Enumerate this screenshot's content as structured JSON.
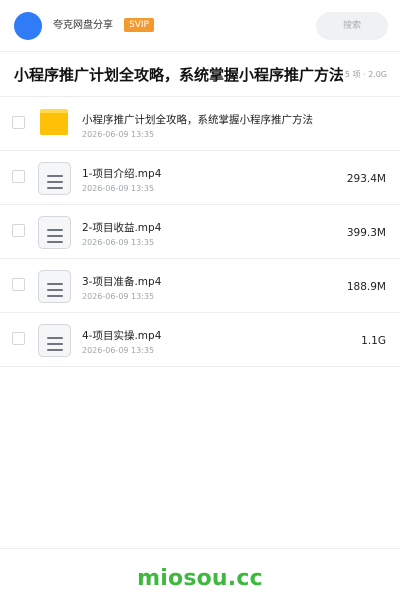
{
  "header": {
    "app_name": "夸克网盘分享",
    "badge": "SVIP",
    "search_placeholder": "搜索",
    "avatar_color": "#2f7cf6"
  },
  "title_row": {
    "title": "小程序推广计划全攻略，系统掌握小程序推广方法",
    "meta": "5 项 · 2.0G"
  },
  "files": [
    {
      "type": "folder",
      "icon": "folder-icon",
      "name": "小程序推广计划全攻略，系统掌握小程序推广方法",
      "date": "2026-06-09 13:35",
      "size": ""
    },
    {
      "type": "video",
      "icon": "file-icon",
      "name": "1-项目介绍.mp4",
      "date": "2026-06-09 13:35",
      "size": "293.4M"
    },
    {
      "type": "video",
      "icon": "file-icon",
      "name": "2-项目收益.mp4",
      "date": "2026-06-09 13:35",
      "size": "399.3M"
    },
    {
      "type": "video",
      "icon": "file-icon",
      "name": "3-项目准备.mp4",
      "date": "2026-06-09 13:35",
      "size": "188.9M"
    },
    {
      "type": "video",
      "icon": "file-icon",
      "name": "4-项目实操.mp4",
      "date": "2026-06-09 13:35",
      "size": "1.1G"
    }
  ],
  "watermark": "miosou.cc",
  "colors": {
    "badge": "#f29a2e",
    "folder": "#ffc107",
    "watermark": "#3fb83f"
  }
}
